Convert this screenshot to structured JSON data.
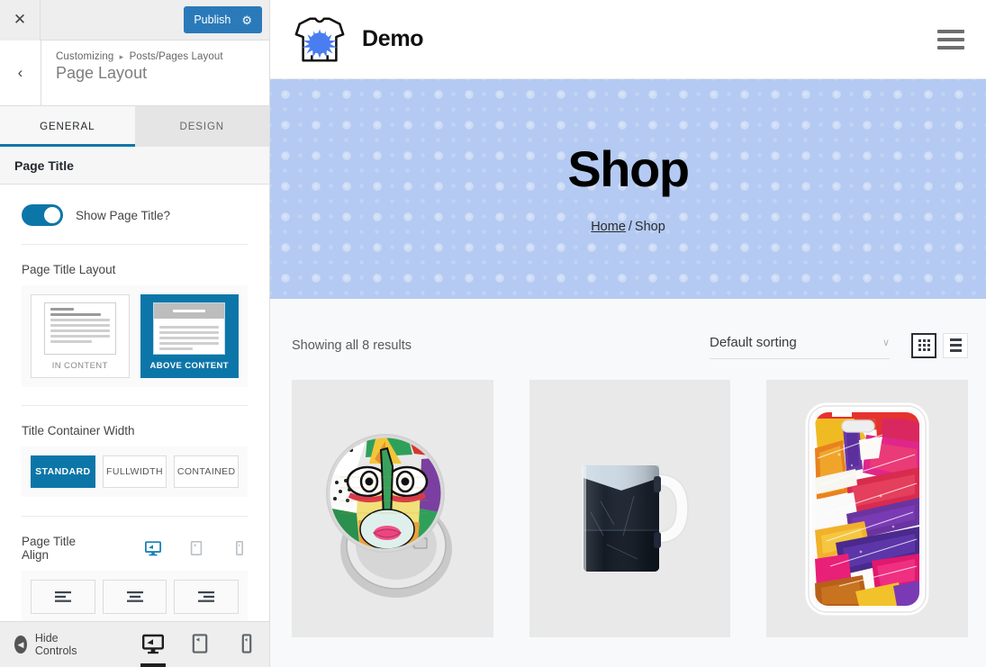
{
  "customizer": {
    "close_label": "✕",
    "publish_label": "Publish",
    "gear_icon": "⚙",
    "back_label": "‹",
    "breadcrumb_parent": "Customizing",
    "breadcrumb_sep": "▸",
    "breadcrumb_current": "Posts/Pages Layout",
    "panel_title": "Page Layout",
    "tabs": [
      {
        "label": "GENERAL",
        "active": true
      },
      {
        "label": "DESIGN",
        "active": false
      }
    ],
    "section_title": "Page Title",
    "show_page_title": {
      "label": "Show Page Title?",
      "value": "on"
    },
    "page_title_layout": {
      "label": "Page Title Layout",
      "options": [
        {
          "caption": "IN CONTENT",
          "selected": false
        },
        {
          "caption": "ABOVE CONTENT",
          "selected": true
        }
      ]
    },
    "title_container_width": {
      "label": "Title Container Width",
      "options": [
        {
          "label": "STANDARD",
          "selected": true
        },
        {
          "label": "FULLWIDTH",
          "selected": false
        },
        {
          "label": "CONTAINED",
          "selected": false
        }
      ]
    },
    "page_title_align": {
      "label": "Page Title Align",
      "devices": [
        {
          "name": "desktop",
          "active": true
        },
        {
          "name": "tablet",
          "active": false
        },
        {
          "name": "mobile",
          "active": false
        }
      ],
      "options": [
        {
          "name": "align-left",
          "selected": false
        },
        {
          "name": "align-center",
          "selected": false
        },
        {
          "name": "align-right",
          "selected": false
        }
      ]
    },
    "footer": {
      "hide_controls_label": "Hide Controls",
      "collapse_icon": "◀",
      "devices": [
        {
          "name": "desktop",
          "active": true
        },
        {
          "name": "tablet",
          "active": false
        },
        {
          "name": "mobile",
          "active": false
        }
      ]
    },
    "accent_color": "#0d76a8",
    "publish_color": "#2a7ab9"
  },
  "preview": {
    "site_header": {
      "brand_name": "Demo",
      "logo_icon": "tshirt-splatter-logo",
      "menu_icon": "hamburger-menu-icon"
    },
    "hero": {
      "title": "Shop",
      "breadcrumb_home": "Home",
      "breadcrumb_sep": "/",
      "breadcrumb_current": "Shop",
      "background_color": "#b4caf2"
    },
    "shop": {
      "results_text": "Showing all 8 results",
      "sorting_value": "Default sorting",
      "sorting_caret": "∨",
      "views": [
        {
          "name": "grid-view",
          "active": true
        },
        {
          "name": "list-view",
          "active": false
        }
      ],
      "products": [
        {
          "name": "pin-badge-abstract-face",
          "art": "badge"
        },
        {
          "name": "dark-ceramic-mug",
          "art": "mug"
        },
        {
          "name": "abstract-paint-phone-case",
          "art": "phonecase"
        }
      ]
    }
  }
}
